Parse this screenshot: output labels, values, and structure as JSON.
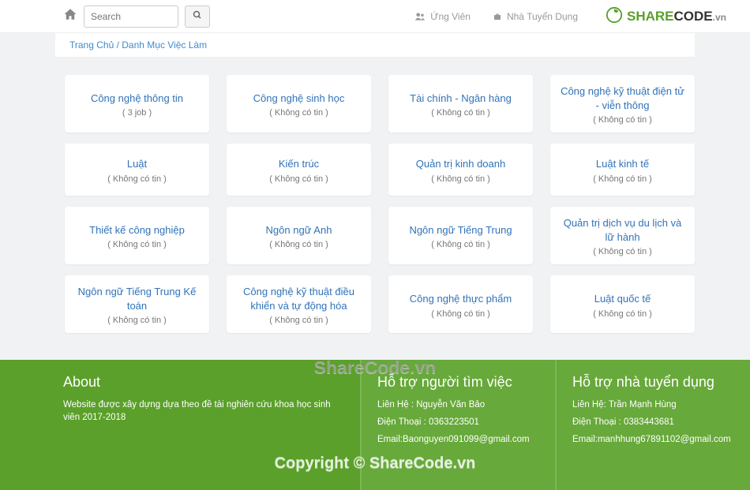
{
  "navbar": {
    "search_placeholder": "Search",
    "candidate": "Ứng Viên",
    "employer": "Nhà Tuyển Dụng"
  },
  "breadcrumb": {
    "home": "Trang Chủ",
    "sep": " / ",
    "current": "Danh Mục Việc Làm"
  },
  "categories": [
    {
      "title": "Công nghệ thông tin",
      "sub": "( 3 job )"
    },
    {
      "title": "Công nghệ sinh học",
      "sub": "( Không có tin )"
    },
    {
      "title": "Tài chính - Ngân hàng",
      "sub": "( Không có tin )"
    },
    {
      "title": "Công nghệ kỹ thuật điện tử - viễn thông",
      "sub": "( Không có tin )"
    },
    {
      "title": "Luật",
      "sub": "( Không có tin )"
    },
    {
      "title": "Kiến trúc",
      "sub": "( Không có tin )"
    },
    {
      "title": "Quản trị kinh doanh",
      "sub": "( Không có tin )"
    },
    {
      "title": "Luật kinh tế",
      "sub": "( Không có tin )"
    },
    {
      "title": "Thiết kế công nghiệp",
      "sub": "( Không có tin )"
    },
    {
      "title": "Ngôn ngữ Anh",
      "sub": "( Không có tin )"
    },
    {
      "title": "Ngôn ngữ Tiếng Trung",
      "sub": "( Không có tin )"
    },
    {
      "title": "Quản trị dịch vụ du lịch và lữ hành",
      "sub": "( Không có tin )"
    },
    {
      "title": "Ngôn ngữ Tiếng Trung Kế toán",
      "sub": "( Không có tin )"
    },
    {
      "title": "Công nghệ kỹ thuật điều khiển và tự động hóa",
      "sub": "( Không có tin )"
    },
    {
      "title": "Công nghệ thực phẩm",
      "sub": "( Không có tin )"
    },
    {
      "title": "Luật quốc tế",
      "sub": "( Không có tin )"
    }
  ],
  "footer": {
    "about_title": "About",
    "about_text": "Website được xây dựng dựa theo đề tài nghiên cứu khoa học sinh viên 2017-2018",
    "jobseeker_title": "Hỗ trợ người tìm việc",
    "jobseeker_contact": "Liên Hệ : Nguyễn Văn Bảo",
    "jobseeker_phone": "Điện Thoại : 0363223501",
    "jobseeker_email": "Email:Baonguyen091099@gmail.com",
    "employer_title": "Hỗ trợ nhà tuyển dụng",
    "employer_contact": "Liên Hệ: Trần Mạnh Hùng",
    "employer_phone": "Điện Thoại : 0383443681",
    "employer_email": "Email:manhhung67891102@gmail.com"
  },
  "watermark": {
    "brand1": "SHARE",
    "brand2": "CODE",
    "brand3": ".vn",
    "center1": "ShareCode.vn",
    "center2": "Copyright © ShareCode.vn"
  }
}
